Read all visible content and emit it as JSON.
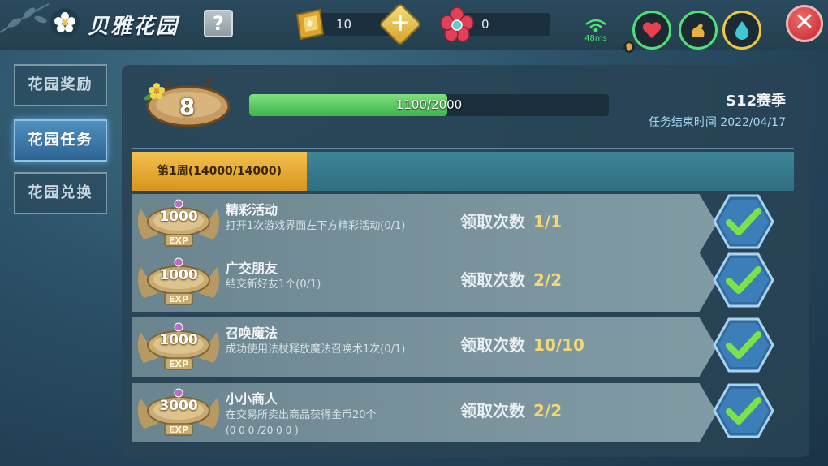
{
  "header": {
    "title": "贝雅花园",
    "help_label": "?",
    "gold_currency": "10",
    "flower_currency": "0",
    "ping": "48ms",
    "close_label": "✕"
  },
  "sidebar": {
    "items": [
      {
        "label": "花园奖励"
      },
      {
        "label": "花园任务"
      },
      {
        "label": "花园兑换"
      }
    ]
  },
  "level": {
    "value": "8"
  },
  "progress": {
    "text": "1100/2000",
    "current": 1100,
    "max": 2000,
    "fraction": 0.55
  },
  "season": {
    "name": "S12赛季",
    "end_time": "任务结束时间 2022/04/17"
  },
  "week": {
    "label": "第1周(14000/14000)"
  },
  "tasks": [
    {
      "exp": "1000",
      "exp_label": "EXP",
      "name": "精彩活动",
      "desc": "打开1次游戏界面左下方精彩活动(0/1)",
      "claim_label": "领取次数",
      "claim_count": "1/1"
    },
    {
      "exp": "1000",
      "exp_label": "EXP",
      "name": "广交朋友",
      "desc": "结交新好友1个(0/1)",
      "claim_label": "领取次数",
      "claim_count": "2/2"
    },
    {
      "exp": "1000",
      "exp_label": "EXP",
      "name": "召唤魔法",
      "desc": "成功使用法杖释放魔法召唤术1次(0/1)",
      "claim_label": "领取次数",
      "claim_count": "10/10"
    },
    {
      "exp": "3000",
      "exp_label": "EXP",
      "name": "小小商人",
      "desc": "在交易所卖出商品获得金币20个",
      "desc2": "(0 0 0 /20 0 0 )",
      "claim_label": "领取次数",
      "claim_count": "2/2"
    }
  ],
  "colors": {
    "progress_fill": "#4fc65a",
    "week_tab": "#e6ab33",
    "check_button": "#2f6aa0",
    "claim_count": "#f3d878"
  }
}
